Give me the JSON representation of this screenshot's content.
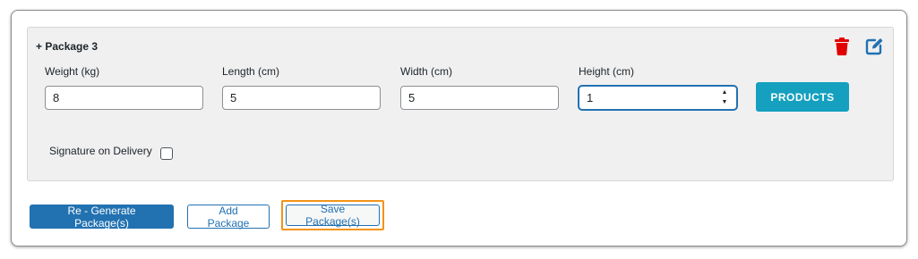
{
  "package": {
    "title": "+ Package 3",
    "delete_icon": "trash-icon",
    "edit_icon": "edit-icon",
    "fields": [
      {
        "label": "Weight (kg)",
        "value": "8"
      },
      {
        "label": "Length (cm)",
        "value": "5"
      },
      {
        "label": "Width (cm)",
        "value": "5"
      },
      {
        "label": "Height (cm)",
        "value": "1"
      }
    ],
    "products_label": "PRODUCTS",
    "signature_label": "Signature on Delivery",
    "signature_checked": false
  },
  "actions": {
    "regenerate_label": "Re - Generate Package(s)",
    "add_label": "Add Package",
    "save_label": "Save Package(s)"
  },
  "colors": {
    "accent": "#2271b1",
    "products": "#14a0be",
    "delete": "#e00000",
    "highlight": "#f29318"
  }
}
